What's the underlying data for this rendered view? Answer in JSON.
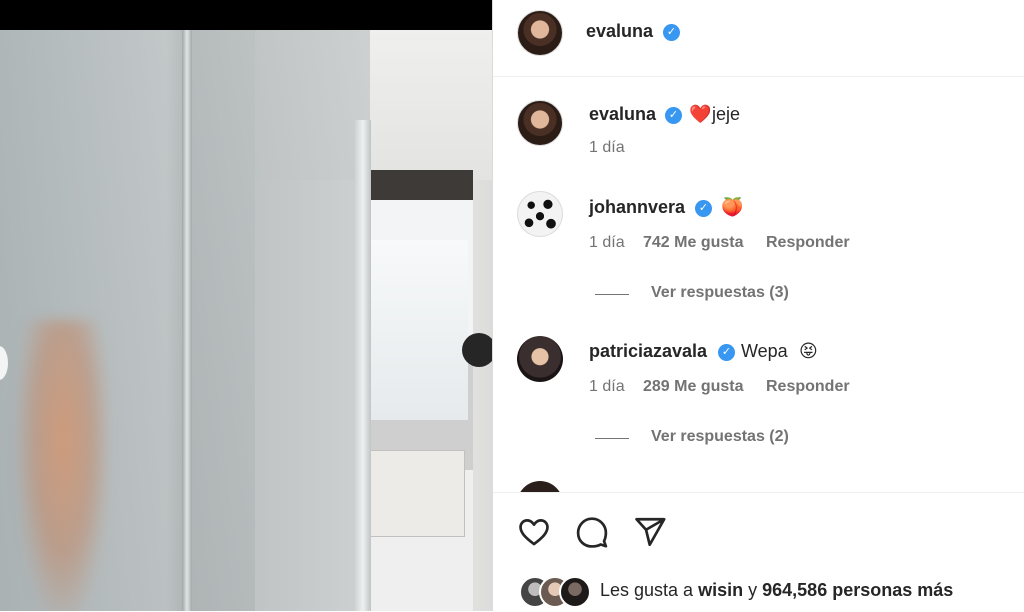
{
  "post": {
    "author": "evaluna",
    "author_verified": true
  },
  "comments": [
    {
      "username": "evaluna",
      "verified": true,
      "emoji": "❤️",
      "text": "jeje",
      "time": "1 día"
    },
    {
      "username": "johannvera",
      "verified": true,
      "emoji": "🍑",
      "text": "",
      "time": "1 día",
      "likes": "742 Me gusta",
      "reply_label": "Responder",
      "view_replies": "Ver respuestas (3)"
    },
    {
      "username": "patriciazavala",
      "verified": true,
      "text": "Wepa",
      "emoji": "😝",
      "time": "1 día",
      "likes": "289 Me gusta",
      "reply_label": "Responder",
      "view_replies": "Ver respuestas (2)"
    }
  ],
  "likes_summary": {
    "prefix": "Les gusta a",
    "user": "wisin",
    "conjunction": "y",
    "count": "964,586 personas más"
  },
  "icons": {
    "like": "heart-icon",
    "comment": "comment-icon",
    "share": "send-icon",
    "verified": "verified-badge-icon"
  },
  "colors": {
    "verified": "#3897f0",
    "text": "#262626",
    "meta": "#737373"
  }
}
